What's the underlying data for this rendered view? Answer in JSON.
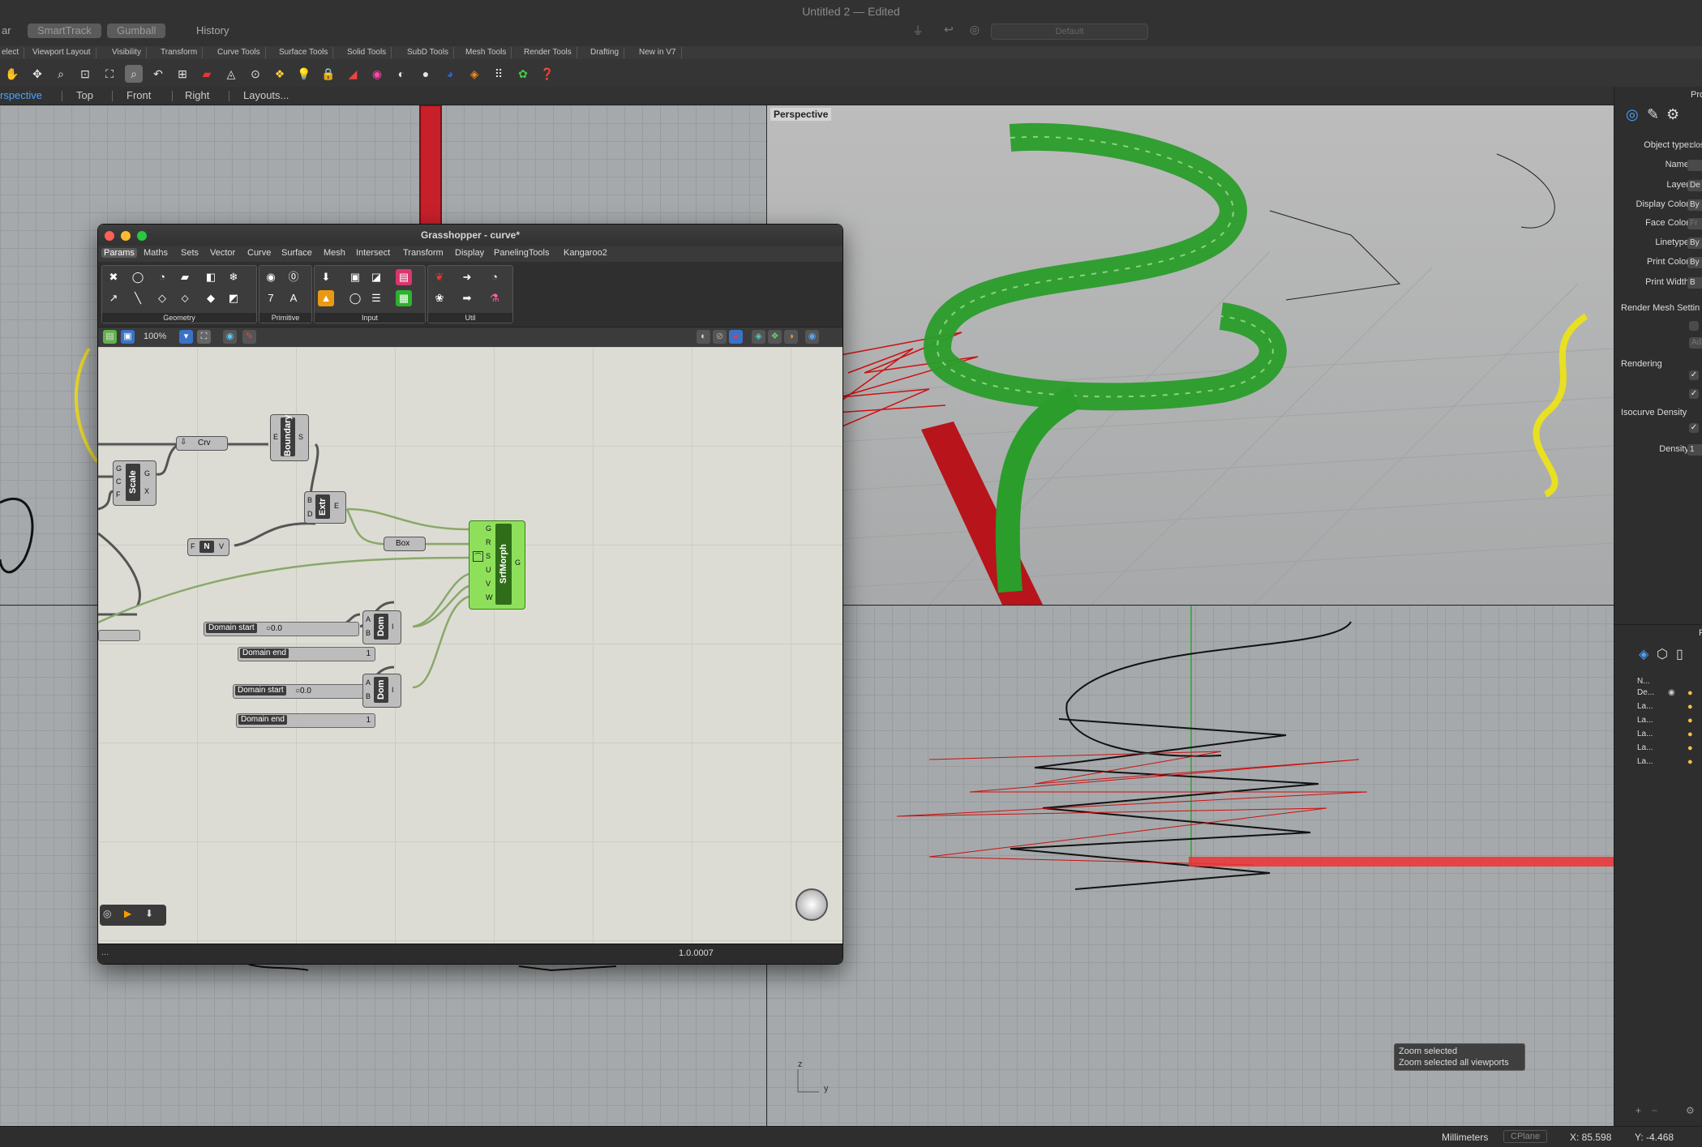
{
  "app": {
    "title": "Untitled 2 — Edited",
    "left_buttons": [
      "ar",
      "SmartTrack",
      "Gumball",
      "History"
    ],
    "view_field": "Default"
  },
  "tabs": [
    "elect",
    "Viewport Layout",
    "Visibility",
    "Transform",
    "Curve Tools",
    "Surface Tools",
    "Solid Tools",
    "SubD Tools",
    "Mesh Tools",
    "Render Tools",
    "Drafting",
    "New in V7"
  ],
  "viewport_tabs": [
    "rspective",
    "Top",
    "Front",
    "Right",
    "Layouts..."
  ],
  "perspective_label": "Perspective",
  "properties": {
    "header": "Pro",
    "rows": [
      {
        "label": "Object type:",
        "value": "clos"
      },
      {
        "label": "Name:",
        "value": ""
      },
      {
        "label": "Layer:",
        "value": "De"
      },
      {
        "label": "Display Color:",
        "value": "By"
      },
      {
        "label": "Face Color:",
        "value": "Fr"
      },
      {
        "label": "Linetype:",
        "value": "By"
      },
      {
        "label": "Print Color:",
        "value": "By"
      },
      {
        "label": "Print Width:",
        "value": "B"
      }
    ],
    "render_mesh": "Render Mesh Settin",
    "render_mesh_btn": "Ad",
    "rendering": "Rendering",
    "isocurve": "Isocurve Density",
    "density_label": "Density:",
    "density_value": "1",
    "layers_header": "N...",
    "layers": [
      "De...",
      "La...",
      "La...",
      "La...",
      "La...",
      "La..."
    ],
    "layers_title": "F"
  },
  "grasshopper": {
    "title": "Grasshopper - curve*",
    "menus": [
      "Params",
      "Maths",
      "Sets",
      "Vector",
      "Curve",
      "Surface",
      "Mesh",
      "Intersect",
      "Transform",
      "Display",
      "PanelingTools",
      "Kangaroo2"
    ],
    "groups": [
      "Geometry",
      "Primitive",
      "Input",
      "Util"
    ],
    "zoom": "100%",
    "status": "1.0.0007",
    "status_left": "...",
    "components": {
      "crv": "Crv",
      "boundary": "Boundary",
      "scale": "Scale",
      "extr": "Extr",
      "box": "Box",
      "srfmorph": "SrfMorph",
      "dom1": "Dom",
      "dom2": "Dom",
      "n": "N"
    },
    "sliders": [
      {
        "label": "Domain start",
        "value": "0.0"
      },
      {
        "label": "Domain end",
        "value": "1"
      },
      {
        "label": "Domain start",
        "value": "0.0"
      },
      {
        "label": "Domain end",
        "value": "1"
      }
    ]
  },
  "tooltip": {
    "line1": "Zoom selected",
    "line2": "Zoom selected all viewports"
  },
  "statusbar": {
    "units": "Millimeters",
    "cplane": "CPlane",
    "x": "X: 85.598",
    "y": "Y: -4.468"
  },
  "axis": {
    "z": "z",
    "y": "y"
  }
}
